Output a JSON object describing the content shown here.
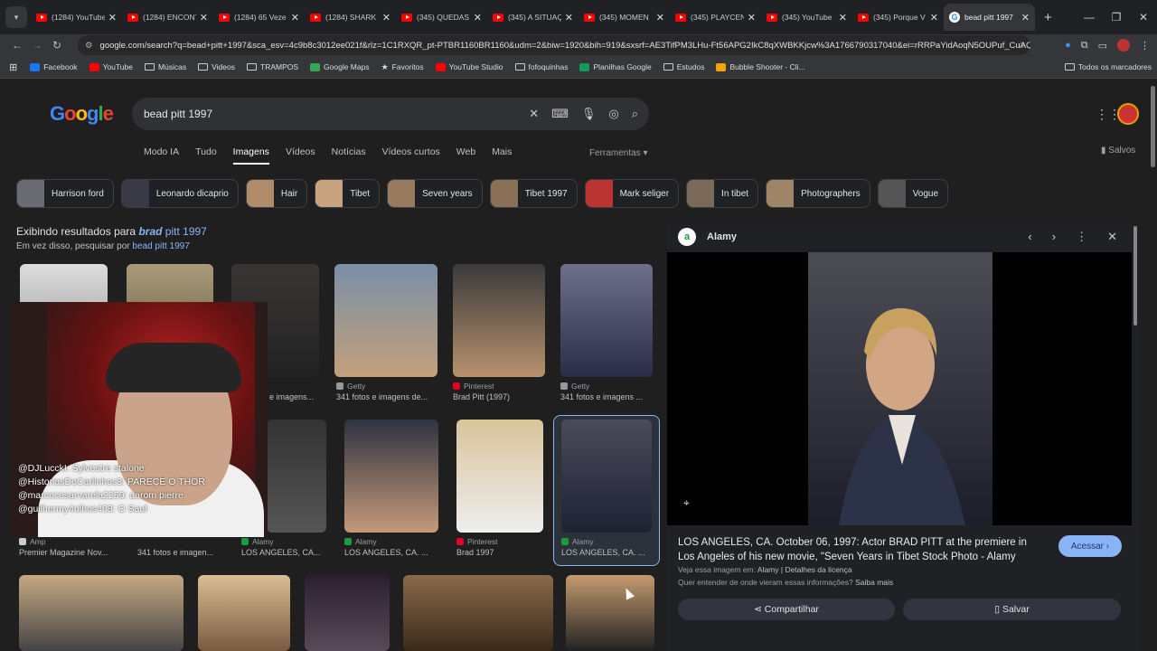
{
  "browser": {
    "tabs": [
      {
        "label": "(1284) YouTube",
        "icon": "youtube-icon"
      },
      {
        "label": "(1284) ENCONT",
        "icon": "youtube-icon"
      },
      {
        "label": "(1284) 65 Veze",
        "icon": "youtube-icon"
      },
      {
        "label": "(1284) SHARK",
        "icon": "youtube-icon"
      },
      {
        "label": "(345) QUEDAS",
        "icon": "youtube-icon"
      },
      {
        "label": "(345) A SITUAÇ",
        "icon": "youtube-icon"
      },
      {
        "label": "(345) MOMEN",
        "icon": "youtube-icon"
      },
      {
        "label": "(345) PLAYCEN",
        "icon": "youtube-icon"
      },
      {
        "label": "(345) YouTube",
        "icon": "youtube-icon"
      },
      {
        "label": "(345) Porque V",
        "icon": "youtube-icon"
      },
      {
        "label": "bead pitt 1997",
        "icon": "google-icon",
        "active": true
      }
    ],
    "url": "google.com/search?q=bead+pitt+1997&sca_esv=4c9b8c3012ee021f&rlz=1C1RXQR_pt-PTBR1160BR1160&udm=2&biw=1920&bih=919&sxsrf=AE3TifPM3LHu-Ft56APG2IkC8qXWBKKjcw%3A1766790317040&ei=rRRPaYidAoqN5OUPuf_CuAQ...",
    "bookmarks": [
      {
        "label": "Facebook",
        "icon": "facebook-icon"
      },
      {
        "label": "YouTube",
        "icon": "youtube-icon"
      },
      {
        "label": "Músicas",
        "icon": "folder-icon"
      },
      {
        "label": "Videos",
        "icon": "folder-icon"
      },
      {
        "label": "TRAMPOS",
        "icon": "folder-icon"
      },
      {
        "label": "Google Maps",
        "icon": "maps-icon"
      },
      {
        "label": "Favoritos",
        "icon": "star-icon"
      },
      {
        "label": "YouTube Studio",
        "icon": "youtube-icon"
      },
      {
        "label": "fofoquinhas",
        "icon": "folder-icon"
      },
      {
        "label": "Planilhas Google",
        "icon": "sheets-icon"
      },
      {
        "label": "Estudos",
        "icon": "folder-icon"
      },
      {
        "label": "Bubble Shooter - Cli...",
        "icon": "game-icon"
      }
    ],
    "all_bookmarks": "Todos os marcadores"
  },
  "google": {
    "logo": "Google",
    "query": "bead pitt 1997",
    "tabs": [
      "Modo IA",
      "Tudo",
      "Imagens",
      "Vídeos",
      "Notícias",
      "Vídeos curtos",
      "Web",
      "Mais"
    ],
    "active_tab": "Imagens",
    "tools": "Ferramentas",
    "saved": "Salvos",
    "chips": [
      "Harrison ford",
      "Leonardo dicaprio",
      "Hair",
      "Tibet",
      "Seven years",
      "Tibet 1997",
      "Mark seliger",
      "In tibet",
      "Photographers",
      "Vogue"
    ],
    "showing_prefix": "Exibindo resultados para",
    "showing_bold": "brad",
    "showing_rest": "pitt 1997",
    "instead_prefix": "Em vez disso, pesquisar por",
    "instead_link": "bead pitt 1997"
  },
  "results": {
    "row1": [
      {
        "source": "",
        "caption": "e imagens..."
      },
      {
        "source": "Getty",
        "caption": "341 fotos e imagens de..."
      },
      {
        "source": "Pinterest",
        "caption": "Brad Pitt (1997)"
      },
      {
        "source": "Getty",
        "caption": "341 fotos e imagens ..."
      }
    ],
    "row2": [
      {
        "source": "Amp",
        "caption": "Premier Magazine Nov..."
      },
      {
        "source": "",
        "caption": "341 fotos e imagen..."
      },
      {
        "source": "Alamy",
        "caption": "LOS ANGELES, CA..."
      },
      {
        "source": "Alamy",
        "caption": "LOS ANGELES, CA. ..."
      },
      {
        "source": "Pinterest",
        "caption": "Brad 1997"
      },
      {
        "source": "Alamy",
        "caption": "LOS ANGELES, CA. ..."
      }
    ]
  },
  "chat": [
    "@DJLucckI: Sylvestre stalone",
    "@HistoriasDoCarlinhos3: PAREÇE O THOR",
    "@marcocesarvarela2259: aarom pierre",
    "@guilhermy4olhos408: O Saul"
  ],
  "panel": {
    "source": "Alamy",
    "title": "LOS ANGELES, CA. October 06, 1997: Actor BRAD PITT at the premiere in Los Angeles of his new movie, \"Seven Years in Tibet Stock Photo - Alamy",
    "see_on_prefix": "Veja essa imagem em:",
    "see_on": "Alamy | Detalhes da licença",
    "ask_prefix": "Quer entender de onde vieram essas informações?",
    "ask_link": "Saiba mais",
    "visit": "Acessar",
    "share": "Compartilhar",
    "save": "Salvar"
  }
}
